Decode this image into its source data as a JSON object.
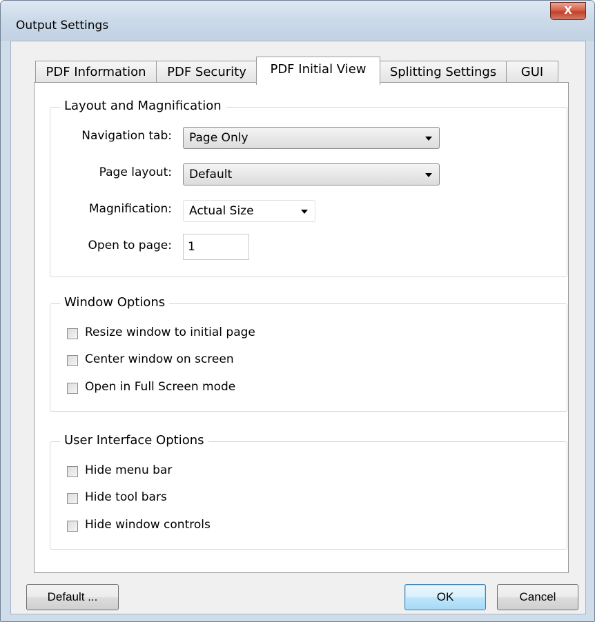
{
  "window": {
    "title": "Output Settings",
    "close_label": "X"
  },
  "tabs": [
    {
      "label": "PDF Information"
    },
    {
      "label": "PDF Security"
    },
    {
      "label": "PDF Initial View",
      "active": true
    },
    {
      "label": "Splitting Settings"
    },
    {
      "label": "GUI"
    }
  ],
  "layout_group": {
    "title": "Layout and Magnification",
    "navigation_tab": {
      "label": "Navigation tab:",
      "value": "Page Only"
    },
    "page_layout": {
      "label": "Page layout:",
      "value": "Default"
    },
    "magnification": {
      "label": "Magnification:",
      "value": "Actual Size"
    },
    "open_to_page": {
      "label": "Open to page:",
      "value": "1"
    }
  },
  "window_group": {
    "title": "Window Options",
    "options": [
      {
        "label": "Resize window to initial page",
        "checked": false
      },
      {
        "label": "Center window on screen",
        "checked": false
      },
      {
        "label": "Open in Full Screen mode",
        "checked": false
      }
    ]
  },
  "ui_group": {
    "title": "User Interface Options",
    "options": [
      {
        "label": "Hide menu bar",
        "checked": false
      },
      {
        "label": "Hide tool bars",
        "checked": false
      },
      {
        "label": "Hide window controls",
        "checked": false
      }
    ]
  },
  "buttons": {
    "default": "Default ...",
    "ok": "OK",
    "cancel": "Cancel"
  },
  "colors": {
    "close_button": "#c8452f",
    "default_button_border": "#3c7fb1",
    "title_bar": "#cbd9e8"
  },
  "icons": {
    "close": "close-icon",
    "dropdown": "chevron-down-icon"
  }
}
